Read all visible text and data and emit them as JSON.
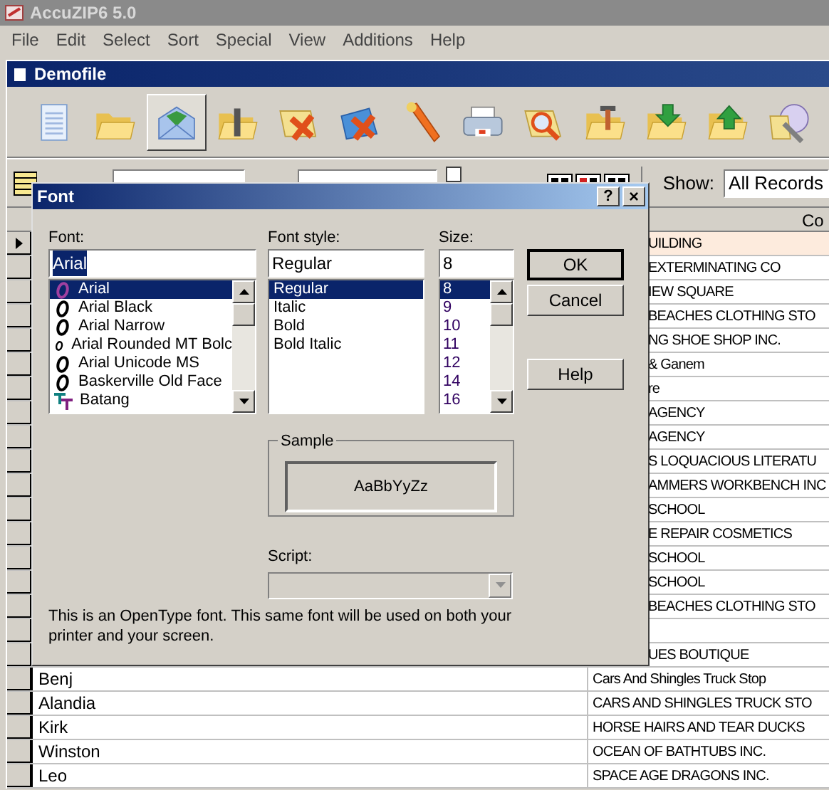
{
  "app": {
    "title": "AccuZIP6 5.0"
  },
  "menu": [
    "File",
    "Edit",
    "Select",
    "Sort",
    "Special",
    "View",
    "Additions",
    "Help"
  ],
  "document_window": {
    "title": "Demofile"
  },
  "toolbar": [
    {
      "kind": "document",
      "selected": false
    },
    {
      "kind": "folder",
      "selected": false
    },
    {
      "kind": "envelope",
      "selected": true
    },
    {
      "kind": "zip-folder",
      "selected": false
    },
    {
      "kind": "folder-delete",
      "selected": false
    },
    {
      "kind": "blue-delete",
      "selected": false
    },
    {
      "kind": "pen",
      "selected": false
    },
    {
      "kind": "printer",
      "selected": false
    },
    {
      "kind": "search",
      "selected": false
    },
    {
      "kind": "tools-folder",
      "selected": false
    },
    {
      "kind": "download-folder",
      "selected": false
    },
    {
      "kind": "upload-folder",
      "selected": false
    },
    {
      "kind": "disc-tools",
      "selected": false
    }
  ],
  "filter_bar": {
    "contains_checked": false,
    "show_label": "Show:",
    "show_value": "All Records"
  },
  "grid": {
    "column_2_header": "Co",
    "rows": [
      {
        "kind": "partial",
        "selected": true,
        "column_2": "UILDING"
      },
      {
        "kind": "partial",
        "selected": false,
        "column_2": "EXTERMINATING CO"
      },
      {
        "kind": "partial",
        "selected": false,
        "column_2": "IEW SQUARE"
      },
      {
        "kind": "partial",
        "selected": false,
        "column_2": "BEACHES CLOTHING STO"
      },
      {
        "kind": "partial",
        "selected": false,
        "column_2": "NG SHOE SHOP INC."
      },
      {
        "kind": "partial",
        "selected": false,
        "column_2": "& Ganem"
      },
      {
        "kind": "partial",
        "selected": false,
        "column_2": "re"
      },
      {
        "kind": "partial",
        "selected": false,
        "column_2": "AGENCY"
      },
      {
        "kind": "partial",
        "selected": false,
        "column_2": "AGENCY"
      },
      {
        "kind": "partial",
        "selected": false,
        "column_2": "S LOQUACIOUS LITERATU"
      },
      {
        "kind": "partial",
        "selected": false,
        "column_2": "AMMERS WORKBENCH INC"
      },
      {
        "kind": "partial",
        "selected": false,
        "column_2": "SCHOOL"
      },
      {
        "kind": "partial",
        "selected": false,
        "column_2": "E REPAIR COSMETICS"
      },
      {
        "kind": "partial",
        "selected": false,
        "column_2": "SCHOOL"
      },
      {
        "kind": "partial",
        "selected": false,
        "column_2": "SCHOOL"
      },
      {
        "kind": "partial",
        "selected": false,
        "column_2": "BEACHES CLOTHING STO"
      },
      {
        "kind": "partial",
        "selected": false
      },
      {
        "kind": "partial",
        "selected": false,
        "column_2": "UES BOUTIQUE"
      },
      {
        "kind": "full",
        "selected": false,
        "column_1": "Benj",
        "column_2": "Cars And Shingles Truck Stop"
      },
      {
        "kind": "full",
        "selected": false,
        "column_1": "Alandia",
        "column_2": "CARS AND SHINGLES TRUCK STO"
      },
      {
        "kind": "full",
        "selected": false,
        "column_1": "Kirk",
        "column_2": "HORSE HAIRS AND TEAR DUCKS"
      },
      {
        "kind": "full",
        "selected": false,
        "column_1": "Winston",
        "column_2": "OCEAN OF BATHTUBS INC."
      },
      {
        "kind": "full",
        "selected": false,
        "column_1": "Leo",
        "column_2": "SPACE AGE DRAGONS INC."
      }
    ]
  },
  "font_dialog": {
    "title": "Font",
    "help_glyph": "?",
    "close_glyph": "×",
    "font_label": "Font:",
    "font_value": "Arial",
    "fonts": [
      {
        "name": "Arial",
        "kind": "opentype",
        "selected": true
      },
      {
        "name": "Arial Black",
        "kind": "opentype",
        "selected": false
      },
      {
        "name": "Arial Narrow",
        "kind": "opentype",
        "selected": false
      },
      {
        "name": "Arial Rounded MT Bolc",
        "kind": "opentype",
        "selected": false
      },
      {
        "name": "Arial Unicode MS",
        "kind": "opentype",
        "selected": false
      },
      {
        "name": "Baskerville Old Face",
        "kind": "opentype",
        "selected": false
      },
      {
        "name": "Batang",
        "kind": "truetype",
        "selected": false
      }
    ],
    "style_label": "Font style:",
    "style_value": "Regular",
    "styles": [
      {
        "name": "Regular",
        "selected": true
      },
      {
        "name": "Italic",
        "selected": false
      },
      {
        "name": "Bold",
        "selected": false
      },
      {
        "name": "Bold Italic",
        "selected": false
      }
    ],
    "size_label": "Size:",
    "size_value": "8",
    "sizes": [
      {
        "name": "8",
        "selected": true
      },
      {
        "name": "9",
        "selected": false
      },
      {
        "name": "10",
        "selected": false
      },
      {
        "name": "11",
        "selected": false
      },
      {
        "name": "12",
        "selected": false
      },
      {
        "name": "14",
        "selected": false
      },
      {
        "name": "16",
        "selected": false
      }
    ],
    "buttons": [
      {
        "label": "OK",
        "default": true
      },
      {
        "label": "Cancel",
        "default": false
      },
      {
        "label": "Help",
        "default": false
      }
    ],
    "sample_label": "Sample",
    "sample_text": "AaBbYyZz",
    "script_label": "Script:",
    "script_disabled": true,
    "description": "This is an OpenType font. This same font will be used on both your printer and your screen."
  }
}
